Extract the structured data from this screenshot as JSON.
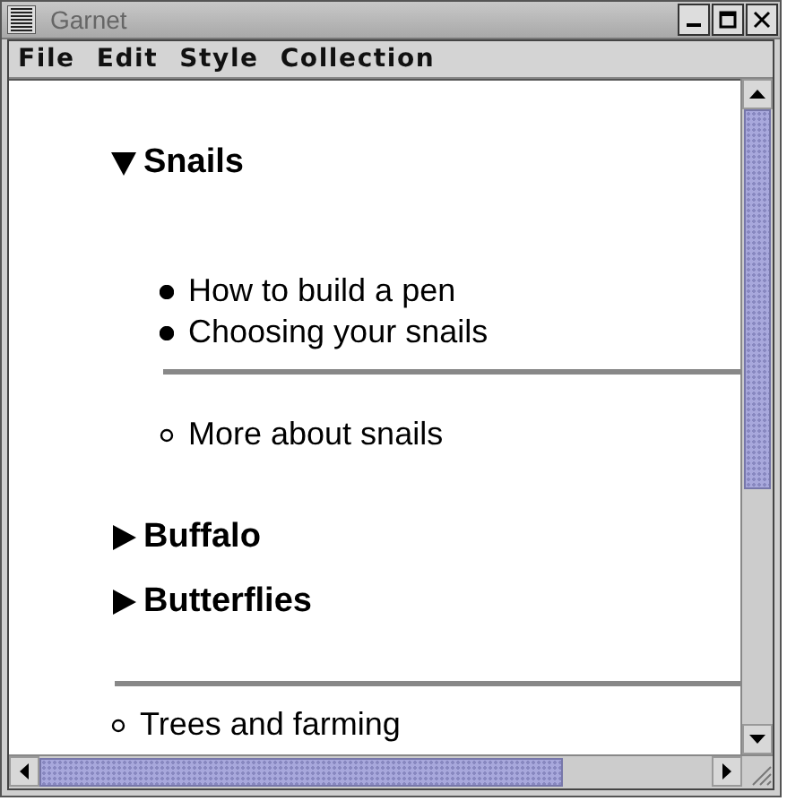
{
  "window": {
    "title": "Garnet"
  },
  "menu": [
    "File",
    "Edit",
    "Style",
    "Collection"
  ],
  "outline": [
    {
      "kind": "section",
      "label": "Snails",
      "expanded": true,
      "children": [
        {
          "kind": "bullet",
          "label": "How to build a pen",
          "filled": true
        },
        {
          "kind": "bullet",
          "label": "Choosing your snails",
          "filled": true
        },
        {
          "kind": "rule"
        },
        {
          "kind": "bullet",
          "label": "More about snails",
          "filled": false
        }
      ]
    },
    {
      "kind": "section",
      "label": "Buffalo",
      "expanded": false
    },
    {
      "kind": "section",
      "label": "Butterflies",
      "expanded": false
    },
    {
      "kind": "rule"
    },
    {
      "kind": "bullet",
      "label": "Trees and farming",
      "filled": false
    }
  ]
}
